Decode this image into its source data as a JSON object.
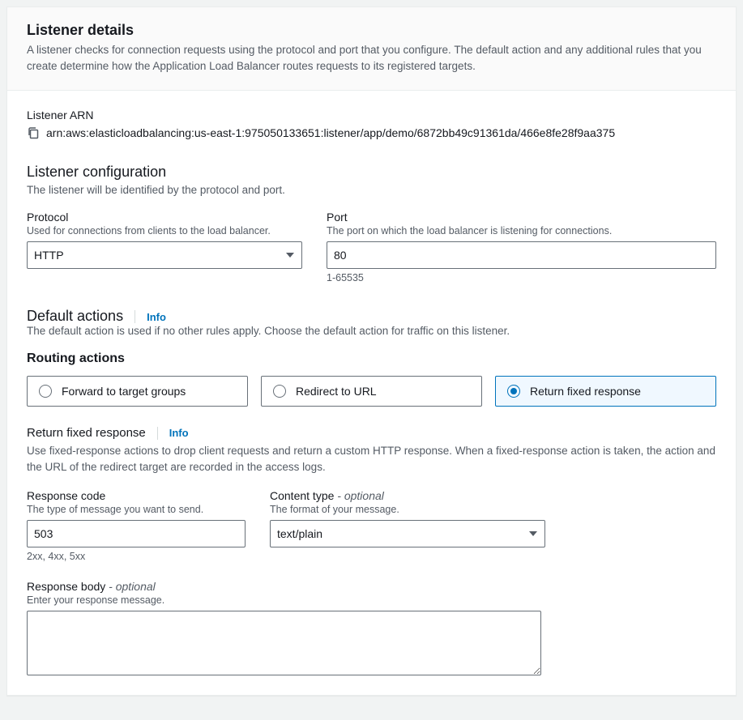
{
  "header": {
    "title": "Listener details",
    "description": "A listener checks for connection requests using the protocol and port that you configure. The default action and any additional rules that you create determine how the Application Load Balancer routes requests to its registered targets."
  },
  "arn": {
    "label": "Listener ARN",
    "value": "arn:aws:elasticloadbalancing:us-east-1:975050133651:listener/app/demo/6872bb49c91361da/466e8fe28f9aa375"
  },
  "config": {
    "title": "Listener configuration",
    "description": "The listener will be identified by the protocol and port.",
    "protocol": {
      "label": "Protocol",
      "help": "Used for connections from clients to the load balancer.",
      "value": "HTTP"
    },
    "port": {
      "label": "Port",
      "help": "The port on which the load balancer is listening for connections.",
      "value": "80",
      "constraint": "1-65535"
    }
  },
  "defaultActions": {
    "title": "Default actions",
    "infoLabel": "Info",
    "description": "The default action is used if no other rules apply. Choose the default action for traffic on this listener.",
    "routingTitle": "Routing actions",
    "options": {
      "forward": "Forward to target groups",
      "redirect": "Redirect to URL",
      "fixed": "Return fixed response"
    }
  },
  "fixedResponse": {
    "title": "Return fixed response",
    "infoLabel": "Info",
    "description": "Use fixed-response actions to drop client requests and return a custom HTTP response. When a fixed-response action is taken, the action and the URL of the redirect target are recorded in the access logs.",
    "responseCode": {
      "label": "Response code",
      "help": "The type of message you want to send.",
      "value": "503",
      "constraint": "2xx, 4xx, 5xx"
    },
    "contentType": {
      "label": "Content type",
      "optional": " - optional",
      "help": "The format of your message.",
      "value": "text/plain"
    },
    "responseBody": {
      "label": "Response body",
      "optional": " - optional",
      "help": "Enter your response message.",
      "value": ""
    }
  }
}
